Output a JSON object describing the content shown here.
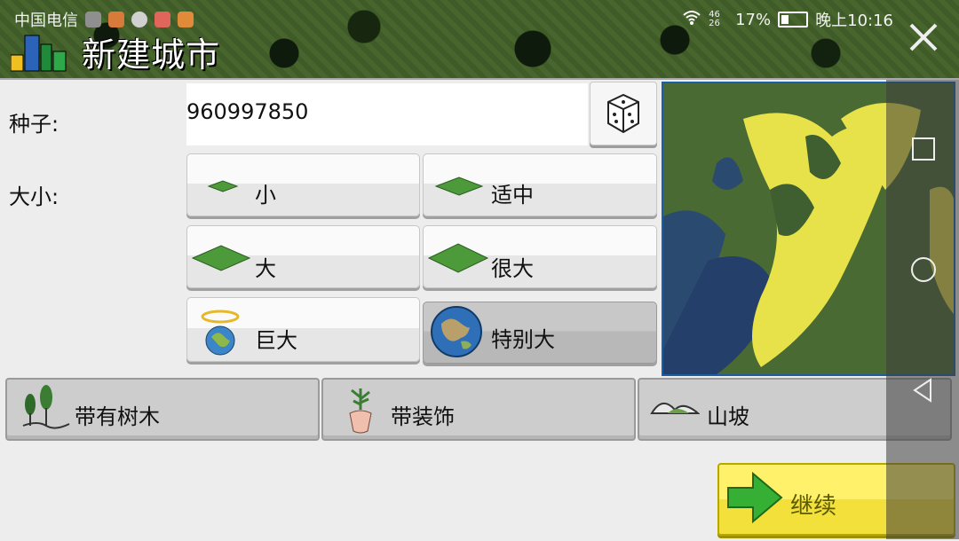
{
  "statusbar": {
    "carrier": "中国电信",
    "signal": "46 26",
    "battery": "17%",
    "time": "晚上10:16"
  },
  "header": {
    "title": "新建城市"
  },
  "form": {
    "seed_label": "种子:",
    "seed_value": "960997850",
    "size_label": "大小:",
    "sizes": [
      {
        "label": "小"
      },
      {
        "label": "适中"
      },
      {
        "label": "大"
      },
      {
        "label": "很大"
      },
      {
        "label": "巨大"
      },
      {
        "label": "特别大"
      }
    ],
    "options": [
      {
        "label": "带有树木"
      },
      {
        "label": "带装饰"
      },
      {
        "label": "山坡"
      }
    ],
    "continue_label": "继续"
  },
  "colors": {
    "panel": "#ededed",
    "map_land": "#e8e24a",
    "map_water": "#1f3c63",
    "continue": "#f3e03a"
  },
  "icons": {
    "close": "close-icon",
    "dice": "dice-icon",
    "nav": [
      "square-icon",
      "circle-icon",
      "back-triangle-icon"
    ]
  }
}
